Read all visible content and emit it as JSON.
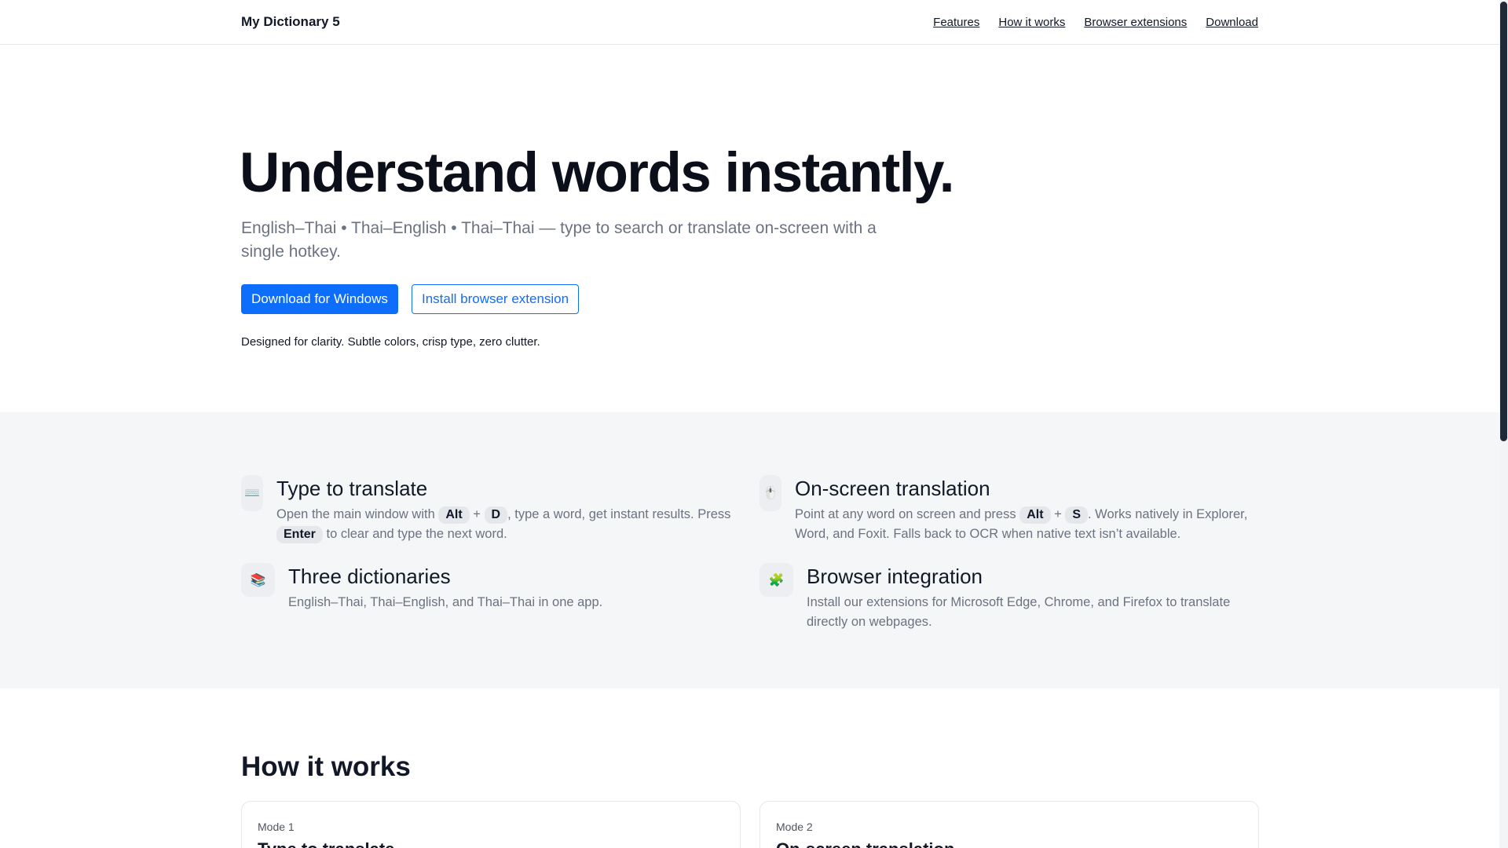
{
  "header": {
    "brand": "My Dictionary 5",
    "nav": [
      "Features",
      "How it works",
      "Browser extensions",
      "Download"
    ]
  },
  "hero": {
    "title": "Understand words instantly.",
    "subtitle": "English–Thai • Thai–English • Thai–Thai — type to search or translate on-screen with a single hotkey.",
    "primary_button": "Download for Windows",
    "secondary_button": "Install browser extension",
    "tagline": "Designed for clarity. Subtle colors, crisp type, zero clutter."
  },
  "features": {
    "type": {
      "icon": "keyboard-icon",
      "glyph": "⌨️",
      "title": "Type to translate",
      "text1": "Open the main window with",
      "key1": "Alt",
      "plus": "+",
      "key2": "D",
      "text2": ", type a word, get instant results. Press",
      "key3": "Enter",
      "text3": "to clear and type the next word."
    },
    "onscreen": {
      "icon": "mouse-icon",
      "glyph": "🖱️",
      "title": "On-screen translation",
      "text1": "Point at any word on screen and press",
      "key1": "Alt",
      "plus": "+",
      "key2": "S",
      "text2": ". Works natively in Explorer, Word, and Foxit. Falls back to OCR when native text isn’t available."
    },
    "three": {
      "icon": "books-icon",
      "glyph": "📚",
      "title": "Three dictionaries",
      "text": "English–Thai, Thai–English, and Thai–Thai in one app."
    },
    "browser": {
      "icon": "puzzle-icon",
      "glyph": "🧩",
      "title": "Browser integration",
      "text": "Install our extensions for Microsoft Edge, Chrome, and Firefox to translate directly on webpages."
    }
  },
  "how": {
    "title": "How it works",
    "modes": [
      {
        "label": "Mode 1",
        "title": "Type to translate"
      },
      {
        "label": "Mode 2",
        "title": "On-screen translation"
      }
    ]
  }
}
